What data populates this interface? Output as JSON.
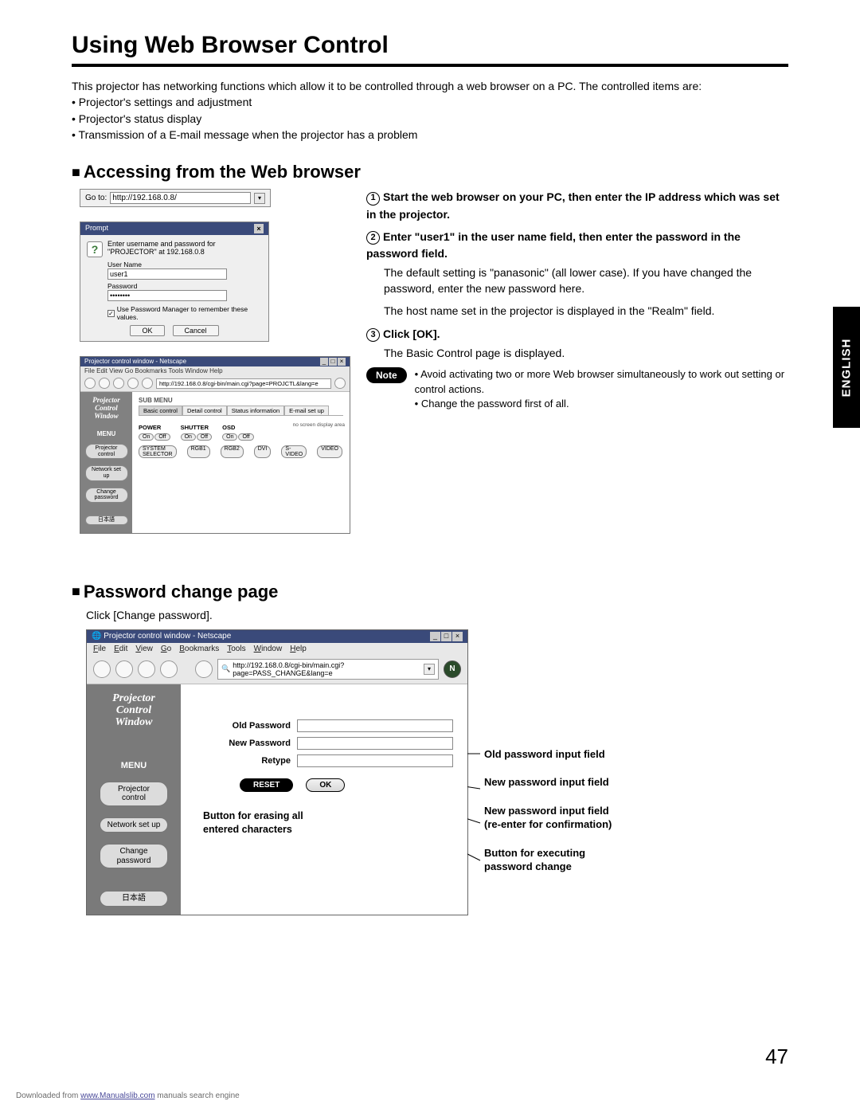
{
  "title": "Using Web Browser Control",
  "intro": "This projector has networking functions which allow it to be controlled through a web browser on a PC.\nThe controlled items are:",
  "intro_bullets": [
    "Projector's settings and adjustment",
    "Projector's status display",
    "Transmission of a E-mail message when the projector has a problem"
  ],
  "section1": {
    "heading": "Accessing from the Web browser",
    "goto_label": "Go to:",
    "goto_url": "http://192.168.0.8/",
    "prompt": {
      "title": "Prompt",
      "msg": "Enter username and password for \"PROJECTOR\" at 192.168.0.8",
      "user_label": "User Name",
      "user_value": "user1",
      "pass_label": "Password",
      "pass_value": "••••••••",
      "remember": "Use Password Manager to remember these values.",
      "ok": "OK",
      "cancel": "Cancel"
    },
    "basic": {
      "win_title": "Projector control window - Netscape",
      "menubar": "File  Edit  View  Go  Bookmarks  Tools  Window  Help",
      "url": "http://192.168.0.8/cgi-bin/main.cgi?page=PROJCTL&lang=e",
      "pcw": "Projector\nControl\nWindow",
      "menu_label": "MENU",
      "side_items": [
        "Projector control",
        "Network set up",
        "Change password"
      ],
      "jp_button": "日本語",
      "sub_menu": "SUB MENU",
      "tabs": [
        "Basic control",
        "Detail control",
        "Status information",
        "E-mail set up"
      ],
      "corner": "no screen display area",
      "power": "POWER",
      "shutter": "SHUTTER",
      "osd": "OSD",
      "on": "On",
      "off": "Off",
      "system": "SYSTEM SELECTOR",
      "rgb1": "RGB1",
      "rgb2": "RGB2",
      "dvi": "DVI",
      "svideo": "S-VIDEO",
      "video": "VIDEO"
    },
    "steps": {
      "s1": "Start the web browser on your PC, then enter the IP address which was set in the projector.",
      "s2": "Enter \"user1\" in the user name field, then enter the password in the password field.",
      "s2_sub1": "The default setting is \"panasonic\" (all lower case). If you have changed the password, enter the new password here.",
      "s2_sub2": "The host name set in the projector is displayed in the \"Realm\" field.",
      "s3": "Click [OK].",
      "s3_sub": "The Basic Control page is displayed."
    },
    "note_label": "Note",
    "note_items": [
      "Avoid activating two or more Web browser simultaneously to work out setting or control actions.",
      "Change the password first of all."
    ]
  },
  "section2": {
    "heading": "Password change page",
    "intro": "Click [Change password].",
    "win": {
      "title": "Projector control window - Netscape",
      "menu": [
        "File",
        "Edit",
        "View",
        "Go",
        "Bookmarks",
        "Tools",
        "Window",
        "Help"
      ],
      "url": "http://192.168.0.8/cgi-bin/main.cgi?page=PASS_CHANGE&lang=e",
      "pcw": "Projector\nControl\nWindow",
      "menu_label": "MENU",
      "side": [
        "Projector control",
        "Network set up",
        "Change password"
      ],
      "jp": "日本語",
      "old": "Old Password",
      "new": "New Password",
      "retype": "Retype",
      "reset": "RESET",
      "ok": "OK",
      "erase_caption": "Button for erasing all\nentered characters"
    },
    "callouts": {
      "c1": "Old password input field",
      "c2": "New password input field",
      "c3": "New password input field\n(re-enter for confirmation)",
      "c4": "Button for executing\npassword change"
    }
  },
  "side_tab": "ENGLISH",
  "page_num": "47",
  "footer_pre": "Downloaded from ",
  "footer_link": "www.Manualslib.com",
  "footer_post": " manuals search engine"
}
